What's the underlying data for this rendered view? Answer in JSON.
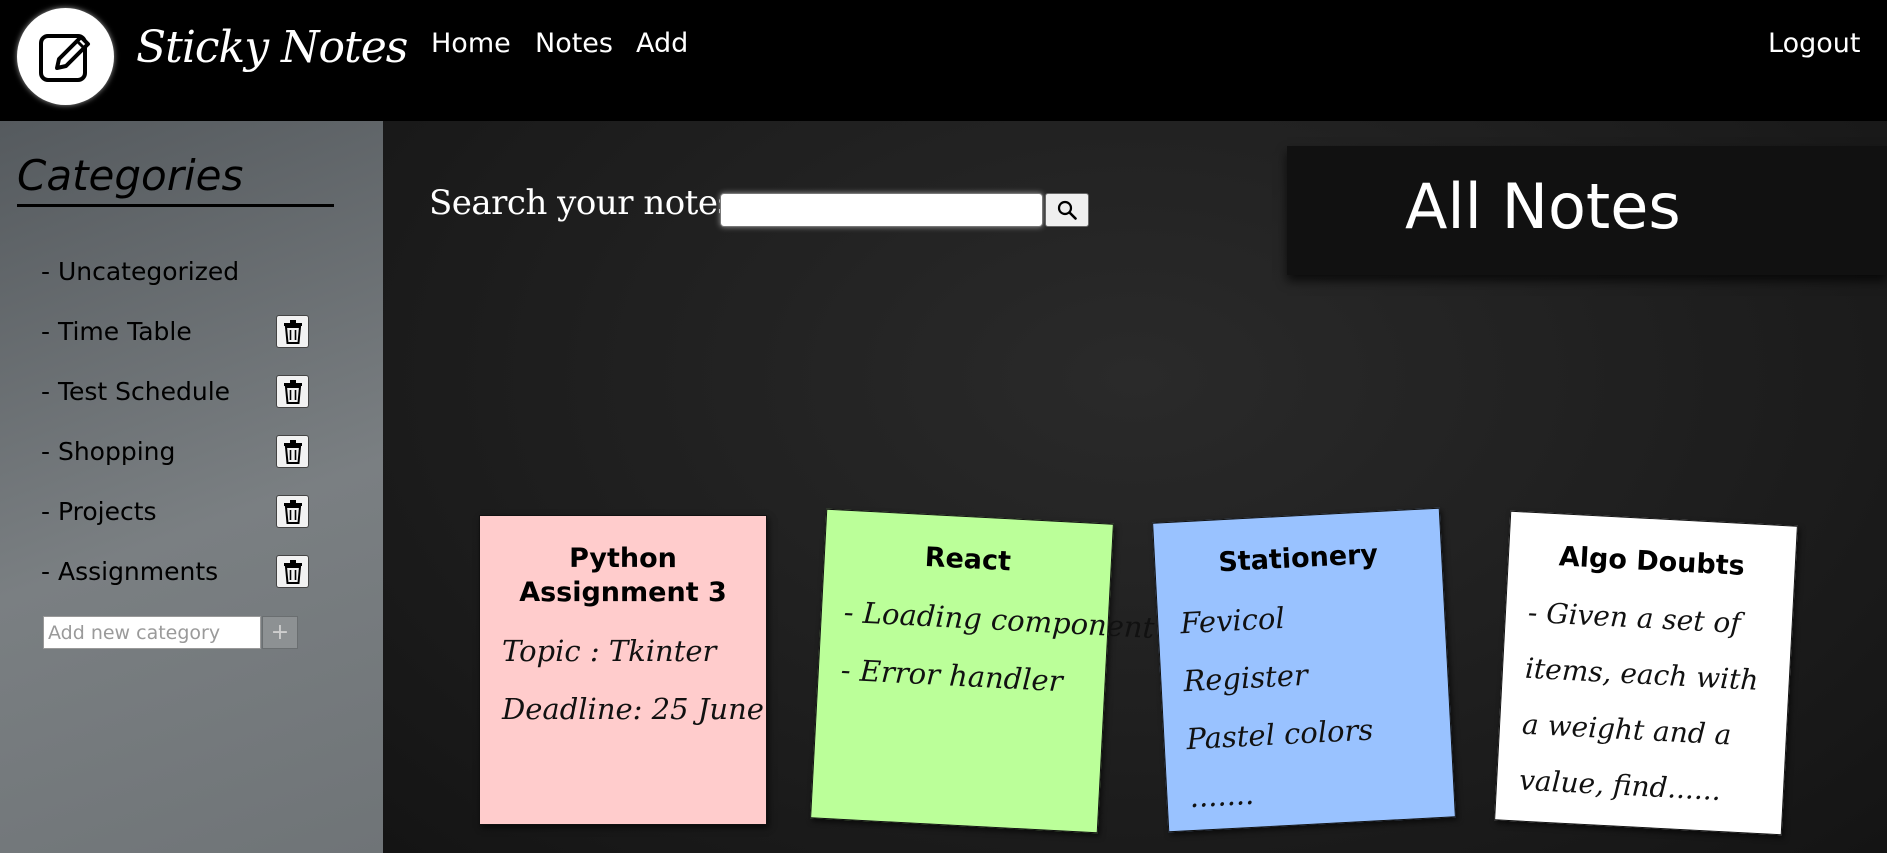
{
  "header": {
    "brand": "Sticky Notes",
    "logo_icon": "edit-note-icon",
    "nav": {
      "home": "Home",
      "notes": "Notes",
      "add": "Add",
      "logout": "Logout"
    }
  },
  "sidebar": {
    "title": "Categories",
    "items": [
      {
        "label": "- Uncategorized",
        "deletable": false
      },
      {
        "label": "- Time Table",
        "deletable": true
      },
      {
        "label": "- Test Schedule",
        "deletable": true
      },
      {
        "label": "- Shopping",
        "deletable": true
      },
      {
        "label": "- Projects",
        "deletable": true
      },
      {
        "label": "- Assignments",
        "deletable": true
      }
    ],
    "new_category_placeholder": "Add new category",
    "add_button_label": "+"
  },
  "main": {
    "search_label": "Search your notes",
    "search_value": "",
    "search_icon": "magnifier-icon",
    "heading": "All Notes"
  },
  "notes": [
    {
      "title": "Python Assignment 3",
      "lines": [
        "Topic : Tkinter",
        "Deadline: 25 June"
      ],
      "color": "#ffcccc"
    },
    {
      "title": "React",
      "lines": [
        "- Loading component",
        "- Error handler"
      ],
      "color": "#bbff99"
    },
    {
      "title": "Stationery",
      "lines": [
        "Fevicol",
        "Register",
        "Pastel colors",
        "......."
      ],
      "color": "#99c2ff"
    },
    {
      "title": "Algo Doubts",
      "lines": [
        "- Given a set of items, each with a weight and a value, find......"
      ],
      "color": "#ffffff"
    }
  ]
}
